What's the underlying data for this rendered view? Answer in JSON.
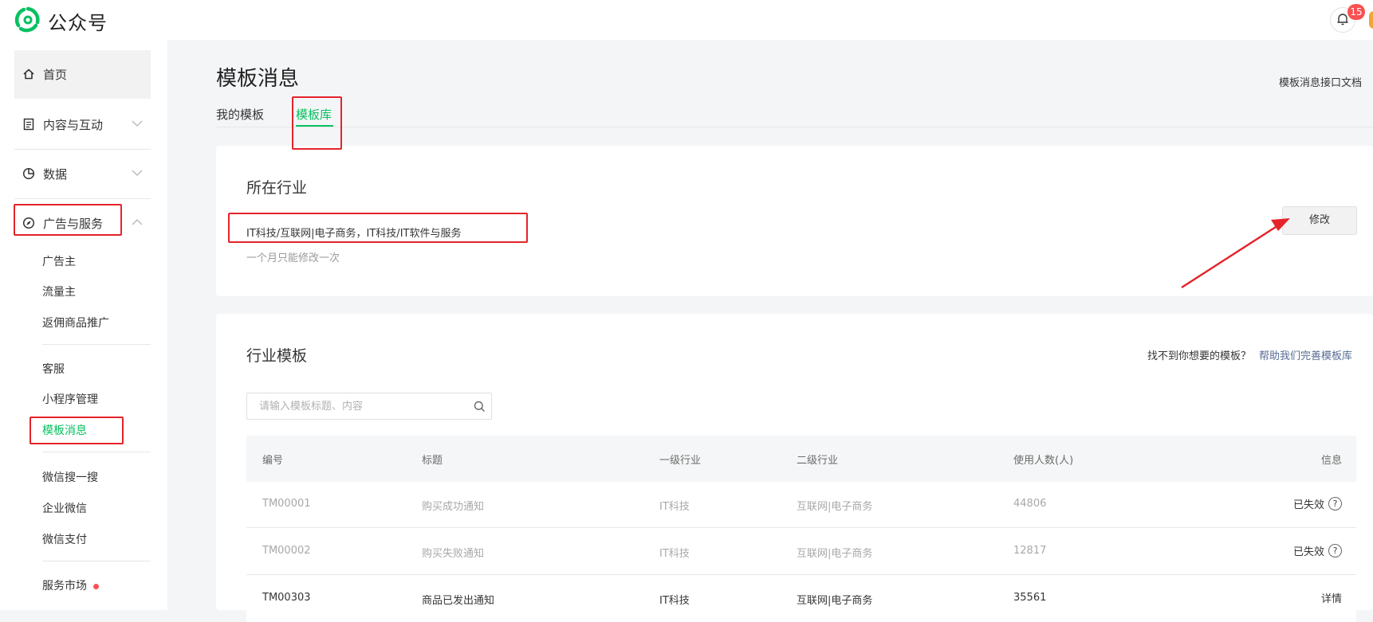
{
  "header": {
    "brand": "公众号",
    "notification_count": "15"
  },
  "sidebar": {
    "home": "首页",
    "content": "内容与互动",
    "data": "数据",
    "ads": "广告与服务",
    "ads_items": [
      "广告主",
      "流量主",
      "返佣商品推广"
    ],
    "service_items": [
      "客服",
      "小程序管理",
      "模板消息"
    ],
    "more_items": [
      "微信搜一搜",
      "企业微信",
      "微信支付"
    ],
    "market": "服务市场"
  },
  "page": {
    "title": "模板消息",
    "doc_link": "模板消息接口文档",
    "tabs": [
      "我的模板",
      "模板库"
    ]
  },
  "industry": {
    "title": "所在行业",
    "value": "IT科技/互联网|电子商务，IT科技/IT软件与服务",
    "hint": "一个月只能修改一次",
    "edit_button": "修改"
  },
  "templates": {
    "title": "行业模板",
    "help_question": "找不到你想要的模板？",
    "help_link": "帮助我们完善模板库",
    "search_placeholder": "请输入模板标题、内容",
    "columns": [
      "编号",
      "标题",
      "一级行业",
      "二级行业",
      "使用人数(人)",
      "信息"
    ],
    "rows": [
      {
        "id": "TM00001",
        "title": "购买成功通知",
        "primary": "IT科技",
        "secondary": "互联网|电子商务",
        "users": "44806",
        "info": "已失效"
      },
      {
        "id": "TM00002",
        "title": "购买失败通知",
        "primary": "IT科技",
        "secondary": "互联网|电子商务",
        "users": "12817",
        "info": "已失效"
      },
      {
        "id": "TM00303",
        "title": "商品已发出通知",
        "primary": "IT科技",
        "secondary": "互联网|电子商务",
        "users": "35561",
        "info": "详情"
      }
    ]
  },
  "colors": {
    "accent": "#07c160",
    "link": "#576b95",
    "annotation": "#e5232a"
  }
}
